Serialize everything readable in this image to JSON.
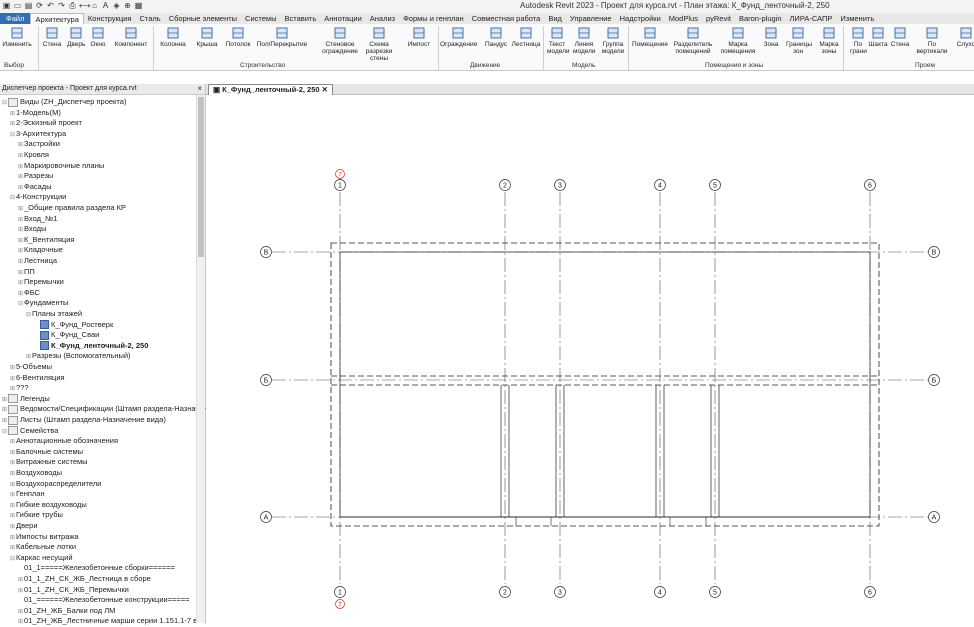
{
  "app_title": "Autodesk Revit 2023 - Проект для курса.rvt - План этажа: К_Фунд_ленточный-2, 250",
  "ribbon_tabs": [
    "Файл",
    "Архитектура",
    "Конструкция",
    "Сталь",
    "Сборные элементы",
    "Системы",
    "Вставить",
    "Аннотации",
    "Анализ",
    "Формы и генплан",
    "Совместная работа",
    "Вид",
    "Управление",
    "Надстройки",
    "ModPlus",
    "pyRevit",
    "Baron-plugin",
    "ЛИРА-САПР",
    "Изменить"
  ],
  "active_tab": "Архитектура",
  "ribbon": {
    "buttons": [
      {
        "label": "Изменить",
        "icon": "cursor-icon"
      },
      {
        "label": "Стена",
        "icon": "wall-icon"
      },
      {
        "label": "Дверь",
        "icon": "door-icon"
      },
      {
        "label": "Окно",
        "icon": "window-icon"
      },
      {
        "label": "Компонент",
        "icon": "component-icon"
      },
      {
        "label": "Колонна",
        "icon": "column-icon"
      },
      {
        "label": "Крыша",
        "icon": "roof-icon"
      },
      {
        "label": "Потолок",
        "icon": "ceiling-icon"
      },
      {
        "label": "Пол/Перекрытие",
        "icon": "floor-icon"
      },
      {
        "label": "Стеновое ограждение",
        "icon": "curtain-wall-icon"
      },
      {
        "label": "Схема разрезки стены",
        "icon": "curtain-grid-icon"
      },
      {
        "label": "Импост",
        "icon": "mullion-icon"
      },
      {
        "label": "Ограждение",
        "icon": "railing-icon"
      },
      {
        "label": "Пандус",
        "icon": "ramp-icon"
      },
      {
        "label": "Лестница",
        "icon": "stair-icon"
      },
      {
        "label": "Текст модели",
        "icon": "model-text-icon"
      },
      {
        "label": "Линия модели",
        "icon": "model-line-icon"
      },
      {
        "label": "Группа модели",
        "icon": "model-group-icon"
      },
      {
        "label": "Помещение",
        "icon": "room-icon"
      },
      {
        "label": "Разделитель помещений",
        "icon": "room-separator-icon"
      },
      {
        "label": "Марка помещения",
        "icon": "room-tag-icon"
      },
      {
        "label": "Зона",
        "icon": "area-icon"
      },
      {
        "label": "Границы зон",
        "icon": "area-boundary-icon"
      },
      {
        "label": "Марка зоны",
        "icon": "area-tag-icon"
      },
      {
        "label": "По грани",
        "icon": "by-face-icon"
      },
      {
        "label": "Шахта",
        "icon": "shaft-icon"
      },
      {
        "label": "Стена",
        "icon": "opening-wall-icon"
      },
      {
        "label": "По вертикали",
        "icon": "vertical-icon"
      },
      {
        "label": "Слухо",
        "icon": "dormer-icon"
      }
    ],
    "panels": [
      "Выбор",
      "Строительство",
      "Движение",
      "Модель",
      "Помещения и зоны",
      "Проем"
    ]
  },
  "project_browser": {
    "title": "Диспетчер проекта - Проект для курса.rvt",
    "items": [
      {
        "label": "Виды (ZH_Диспетчер проекта)",
        "level": 0,
        "exp": "⊟",
        "type": "views"
      },
      {
        "label": "1-Модель(М)",
        "level": 1,
        "exp": "⊞"
      },
      {
        "label": "2-Эскизный проект",
        "level": 1,
        "exp": "⊞"
      },
      {
        "label": "3-Архитектура",
        "level": 1,
        "exp": "⊟"
      },
      {
        "label": "Застройки",
        "level": 2,
        "exp": "⊞"
      },
      {
        "label": "Кровля",
        "level": 2,
        "exp": "⊞"
      },
      {
        "label": "Маркировочные планы",
        "level": 2,
        "exp": "⊞"
      },
      {
        "label": "Разрезы",
        "level": 2,
        "exp": "⊞"
      },
      {
        "label": "Фасады",
        "level": 2,
        "exp": "⊞"
      },
      {
        "label": "4-Конструкции",
        "level": 1,
        "exp": "⊟"
      },
      {
        "label": "_Общие правила раздела КР",
        "level": 2,
        "exp": "⊞"
      },
      {
        "label": "Вход_№1",
        "level": 2,
        "exp": "⊞"
      },
      {
        "label": "Входы",
        "level": 2,
        "exp": "⊞"
      },
      {
        "label": "К_Вентиляция",
        "level": 2,
        "exp": "⊞"
      },
      {
        "label": "Кладочные",
        "level": 2,
        "exp": "⊞"
      },
      {
        "label": "Лестница",
        "level": 2,
        "exp": "⊞"
      },
      {
        "label": "ПП",
        "level": 2,
        "exp": "⊞"
      },
      {
        "label": "Перемычки",
        "level": 2,
        "exp": "⊞"
      },
      {
        "label": "ФБС",
        "level": 2,
        "exp": "⊞"
      },
      {
        "label": "Фундаменты",
        "level": 2,
        "exp": "⊟"
      },
      {
        "label": "Планы этажей",
        "level": 3,
        "exp": "⊟"
      },
      {
        "label": "К_Фунд_Ростверк",
        "level": 4,
        "exp": "",
        "type": "view"
      },
      {
        "label": "К_Фунд_Сваи",
        "level": 4,
        "exp": "",
        "type": "view"
      },
      {
        "label": "К_Фунд_ленточный-2, 250",
        "level": 4,
        "exp": "",
        "type": "view",
        "bold": true
      },
      {
        "label": "Разрезы (Вспомогательный)",
        "level": 3,
        "exp": "⊞"
      },
      {
        "label": "5-Объемы",
        "level": 1,
        "exp": "⊞"
      },
      {
        "label": "6-Вентиляция",
        "level": 1,
        "exp": "⊞"
      },
      {
        "label": "???",
        "level": 1,
        "exp": "⊞"
      },
      {
        "label": "Легенды",
        "level": 0,
        "exp": "⊞",
        "type": "folder"
      },
      {
        "label": "Ведомости/Спецификации (Штамп раздела-Назначение вида)",
        "level": 0,
        "exp": "⊞",
        "type": "folder"
      },
      {
        "label": "Листы (Штамп раздела-Назначение вида)",
        "level": 0,
        "exp": "⊞",
        "type": "folder"
      },
      {
        "label": "Семейства",
        "level": 0,
        "exp": "⊟",
        "type": "folder"
      },
      {
        "label": "Аннотационные обозначения",
        "level": 1,
        "exp": "⊞"
      },
      {
        "label": "Балочные системы",
        "level": 1,
        "exp": "⊞"
      },
      {
        "label": "Витражные системы",
        "level": 1,
        "exp": "⊞"
      },
      {
        "label": "Воздуховоды",
        "level": 1,
        "exp": "⊞"
      },
      {
        "label": "Воздухораспределители",
        "level": 1,
        "exp": "⊞"
      },
      {
        "label": "Генплан",
        "level": 1,
        "exp": "⊞"
      },
      {
        "label": "Гибкие воздуховоды",
        "level": 1,
        "exp": "⊞"
      },
      {
        "label": "Гибкие трубы",
        "level": 1,
        "exp": "⊞"
      },
      {
        "label": "Двери",
        "level": 1,
        "exp": "⊞"
      },
      {
        "label": "Импосты витража",
        "level": 1,
        "exp": "⊞"
      },
      {
        "label": "Кабельные лотки",
        "level": 1,
        "exp": "⊞"
      },
      {
        "label": "Каркас несущий",
        "level": 1,
        "exp": "⊟"
      },
      {
        "label": "01_1=====Железобетонные сборки======",
        "level": 2,
        "exp": ""
      },
      {
        "label": "01_1_ZH_СК_ЖБ_Лестница в сборе",
        "level": 2,
        "exp": "⊞"
      },
      {
        "label": "01_1_ZH_СК_ЖБ_Перемычки",
        "level": 2,
        "exp": "⊞"
      },
      {
        "label": "01_======Железобетонные конструкции=====",
        "level": 2,
        "exp": ""
      },
      {
        "label": "01_ZH_ЖБ_Балки под ЛМ",
        "level": 2,
        "exp": "⊞"
      },
      {
        "label": "01_ZH_ЖБ_Лестничные марши серии 1.151.1-7 в",
        "level": 2,
        "exp": "⊞"
      }
    ]
  },
  "view_tab": {
    "label": "К_Фунд_ленточный-2, 250",
    "close": "✕"
  },
  "grid": {
    "vertical": [
      {
        "label": "1"
      },
      {
        "label": "2"
      },
      {
        "label": "3"
      },
      {
        "label": "4"
      },
      {
        "label": "5"
      },
      {
        "label": "6"
      },
      {
        "label": "7"
      }
    ],
    "horizontal": [
      {
        "label": "В"
      },
      {
        "label": "Б"
      },
      {
        "label": "А"
      }
    ]
  }
}
